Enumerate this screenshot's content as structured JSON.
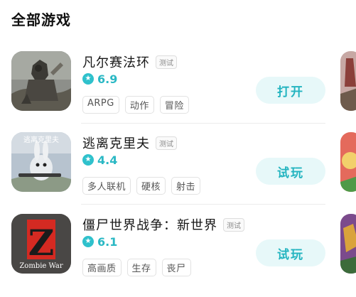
{
  "section": {
    "title": "全部游戏"
  },
  "games": [
    {
      "name": "凡尔赛法环",
      "badge": "测试",
      "rating": "6.9",
      "tags": [
        "ARPG",
        "动作",
        "冒险"
      ],
      "action": "打开",
      "icon": "knight-cover-art"
    },
    {
      "name": "逃离克里夫",
      "badge": "测试",
      "rating": "4.4",
      "tags": [
        "多人联机",
        "硬核",
        "射击"
      ],
      "action": "试玩",
      "icon": "rabbit-cover-art",
      "cover_text": "逃离克里夫"
    },
    {
      "name": "僵尸世界战争：新世界",
      "badge": "测试",
      "rating": "6.1",
      "tags": [
        "高画质",
        "生存",
        "丧尸"
      ],
      "action": "试玩",
      "icon": "zombie-war-cover-art",
      "cover_text": "Zombie War",
      "cover_letter": "Z"
    }
  ],
  "colors": {
    "accent": "#2ab8c4",
    "button_bg": "#e7f8f9"
  }
}
